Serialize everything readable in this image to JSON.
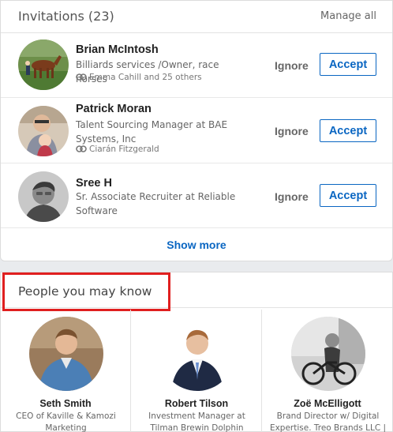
{
  "invitations": {
    "title": "Invitations (23)",
    "manage_all": "Manage all",
    "ignore_label": "Ignore",
    "accept_label": "Accept",
    "items": [
      {
        "name": "Brian McIntosh",
        "headline": "Billiards services /Owner, race horses",
        "mutual": "Emma Cahill and 25 others",
        "avatar": "person-with-horse-photo"
      },
      {
        "name": "Patrick Moran",
        "headline": "Talent Sourcing Manager at BAE Systems, Inc",
        "mutual": "Ciarán Fitzgerald",
        "avatar": "person-with-child-photo"
      },
      {
        "name": "Sree H",
        "headline": "Sr. Associate Recruiter at Reliable Software",
        "mutual": "",
        "avatar": "person-grayscale-photo"
      }
    ],
    "show_more": "Show more"
  },
  "pymk": {
    "title": "People you may know",
    "people": [
      {
        "name": "Seth Smith",
        "headline": "CEO of Kaville & Kamozi Marketing",
        "avatar": "man-denim-jacket-photo"
      },
      {
        "name": "Robert Tilson",
        "headline": "Investment Manager at Tilman Brewin Dolphin",
        "avatar": "man-in-suit-photo"
      },
      {
        "name": "Zoë McElligott",
        "headline": "Brand Director w/ Digital Expertise. Treo Brands LLC |",
        "avatar": "woman-with-bicycle-photo"
      }
    ]
  },
  "colors": {
    "accent": "#0a66c2",
    "highlight_box": "#e01f1f",
    "background": "#e9ebee"
  }
}
